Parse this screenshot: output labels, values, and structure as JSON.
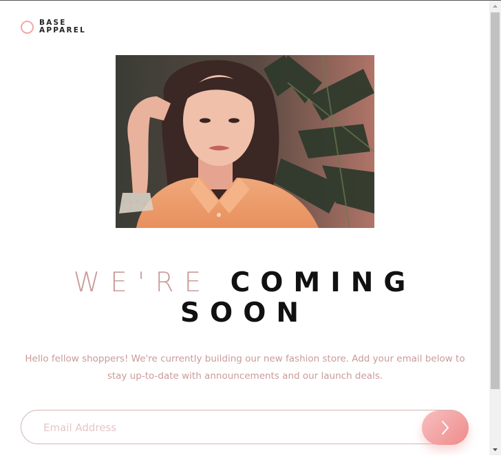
{
  "brand": {
    "line1": "BASE",
    "line2": "APPAREL",
    "accent": "#f0a9a4"
  },
  "hero": {
    "image": "portrait-photo"
  },
  "headline": {
    "light": "WE'RE",
    "bold_line1": "COMING",
    "bold_line2": "SOON"
  },
  "intro": "Hello fellow shoppers! We're currently building our new fashion store. Add your email below to stay up-to-date with announcements and our launch deals.",
  "signup": {
    "placeholder": "Email Address",
    "value": "",
    "submit_icon": "chevron-right-icon"
  },
  "colors": {
    "desaturated_red": "#c99b98",
    "dark": "#111111",
    "gradient_start": "#f8bfbf",
    "gradient_end": "#ee8b8b"
  }
}
